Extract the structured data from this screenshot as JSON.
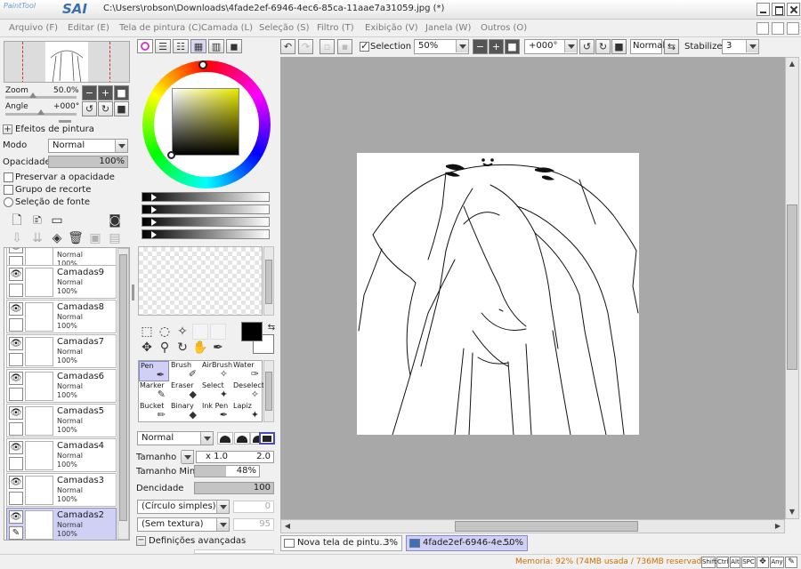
{
  "app": {
    "logo_top": "PaintTool",
    "logo_main": "SAI",
    "window_title": "C:\\Users\\robson\\Downloads\\4fade2ef-6946-4ec6-85ca-11aae7a31059.jpg (*)"
  },
  "menu": [
    {
      "label": "Arquivo (F)",
      "name": "menu-arquivo"
    },
    {
      "label": "Editar (E)",
      "name": "menu-editar"
    },
    {
      "label": "Tela de pintura (C)",
      "name": "menu-tela-de-pintura"
    },
    {
      "label": "Camada (L)",
      "name": "menu-camada"
    },
    {
      "label": "Seleção (S)",
      "name": "menu-selecao"
    },
    {
      "label": "Filtro (T)",
      "name": "menu-filtro"
    },
    {
      "label": "Exibição (V)",
      "name": "menu-exibicao"
    },
    {
      "label": "Janela (W)",
      "name": "menu-janela"
    },
    {
      "label": "Outros (O)",
      "name": "menu-outros"
    }
  ],
  "navigator": {
    "zoom_label": "Zoom",
    "zoom_value": "50.0%",
    "angle_label": "Angle",
    "angle_value": "+000°"
  },
  "layer_panel": {
    "effects_label": "Efeitos de pintura",
    "mode_label": "Modo",
    "mode_value": "Normal",
    "opacity_label": "Opacidade",
    "opacity_value": "100%",
    "opacity_fraction": 1.0,
    "preserve_opacity": "Preservar a opacidade",
    "clip_group": "Grupo de recorte",
    "source_selection": "Seleção de fonte"
  },
  "layers": [
    {
      "name": "",
      "mode": "Normal",
      "opacity": "100%",
      "selected": false
    },
    {
      "name": "Camadas9",
      "mode": "Normal",
      "opacity": "100%",
      "selected": false
    },
    {
      "name": "Camadas8",
      "mode": "Normal",
      "opacity": "100%",
      "selected": false
    },
    {
      "name": "Camadas7",
      "mode": "Normal",
      "opacity": "100%",
      "selected": false
    },
    {
      "name": "Camadas6",
      "mode": "Normal",
      "opacity": "100%",
      "selected": false
    },
    {
      "name": "Camadas5",
      "mode": "Normal",
      "opacity": "100%",
      "selected": false
    },
    {
      "name": "Camadas4",
      "mode": "Normal",
      "opacity": "100%",
      "selected": false
    },
    {
      "name": "Camadas3",
      "mode": "Normal",
      "opacity": "100%",
      "selected": false
    },
    {
      "name": "Camadas2",
      "mode": "Normal",
      "opacity": "100%",
      "selected": true
    }
  ],
  "colors": {
    "primary": "#000000",
    "secondary": "#ffffff",
    "hue_accent": "#e8e800",
    "selection_bg": "#cfd0f4",
    "memory_text": "#d07000"
  },
  "tools": [
    {
      "label": "Pen",
      "icon": "pen-icon",
      "glyph": "✒",
      "selected": true
    },
    {
      "label": "Brush",
      "icon": "brush-icon",
      "glyph": "✐",
      "selected": false
    },
    {
      "label": "AirBrush",
      "icon": "airbrush-icon",
      "glyph": "✧",
      "selected": false
    },
    {
      "label": "Water",
      "icon": "water-icon",
      "glyph": "✑",
      "selected": false
    },
    {
      "label": "Marker",
      "icon": "marker-icon",
      "glyph": "✎",
      "selected": false
    },
    {
      "label": "Eraser",
      "icon": "eraser-icon",
      "glyph": "◆",
      "selected": false
    },
    {
      "label": "Select",
      "icon": "select-icon",
      "glyph": "✦",
      "selected": false
    },
    {
      "label": "Deselect",
      "icon": "deselect-icon",
      "glyph": "✧",
      "selected": false
    },
    {
      "label": "Bucket",
      "icon": "bucket-icon",
      "glyph": "✏",
      "selected": false
    },
    {
      "label": "Binary",
      "icon": "binary-icon",
      "glyph": "◆",
      "selected": false
    },
    {
      "label": "Ink Pen",
      "icon": "ink-pen-icon",
      "glyph": "✒",
      "selected": false
    },
    {
      "label": "Lapiz",
      "icon": "lapiz-icon",
      "glyph": "✦",
      "selected": false
    }
  ],
  "brush": {
    "blend_mode": "Normal",
    "size_label": "Tamanho",
    "size_multiplier": "x 1.0",
    "size_value": "2.0",
    "min_size_label": "Tamanho Min",
    "min_size_value": "48%",
    "min_size_fraction": 0.48,
    "density_label": "Dencidade",
    "density_value": "100",
    "density_fraction": 1.0,
    "shape_select": "(Círculo simples)",
    "shape_value": "0",
    "texture_select": "(Sem textura)",
    "texture_value": "95",
    "advanced_label": "Definições avançadas"
  },
  "canvas_toolbar": {
    "selection_label": "Selection",
    "selection_checked": true,
    "zoom_value": "50%",
    "angle_value": "+000°",
    "blend_value": "Normal",
    "stabilizer_label": "Stabilizer",
    "stabilizer_value": "3"
  },
  "documents": [
    {
      "name": "Nova tela de pintu...",
      "percent": "3%",
      "selected": false
    },
    {
      "name": "4fade2ef-6946-4e...",
      "percent": "50%",
      "selected": true
    }
  ],
  "statusbar": {
    "memory": "Memoria: 92% (74MB usada / 736MB reservada)",
    "keys": [
      "Shift",
      "Ctrl",
      "Alt",
      "SPC",
      "Any"
    ]
  }
}
